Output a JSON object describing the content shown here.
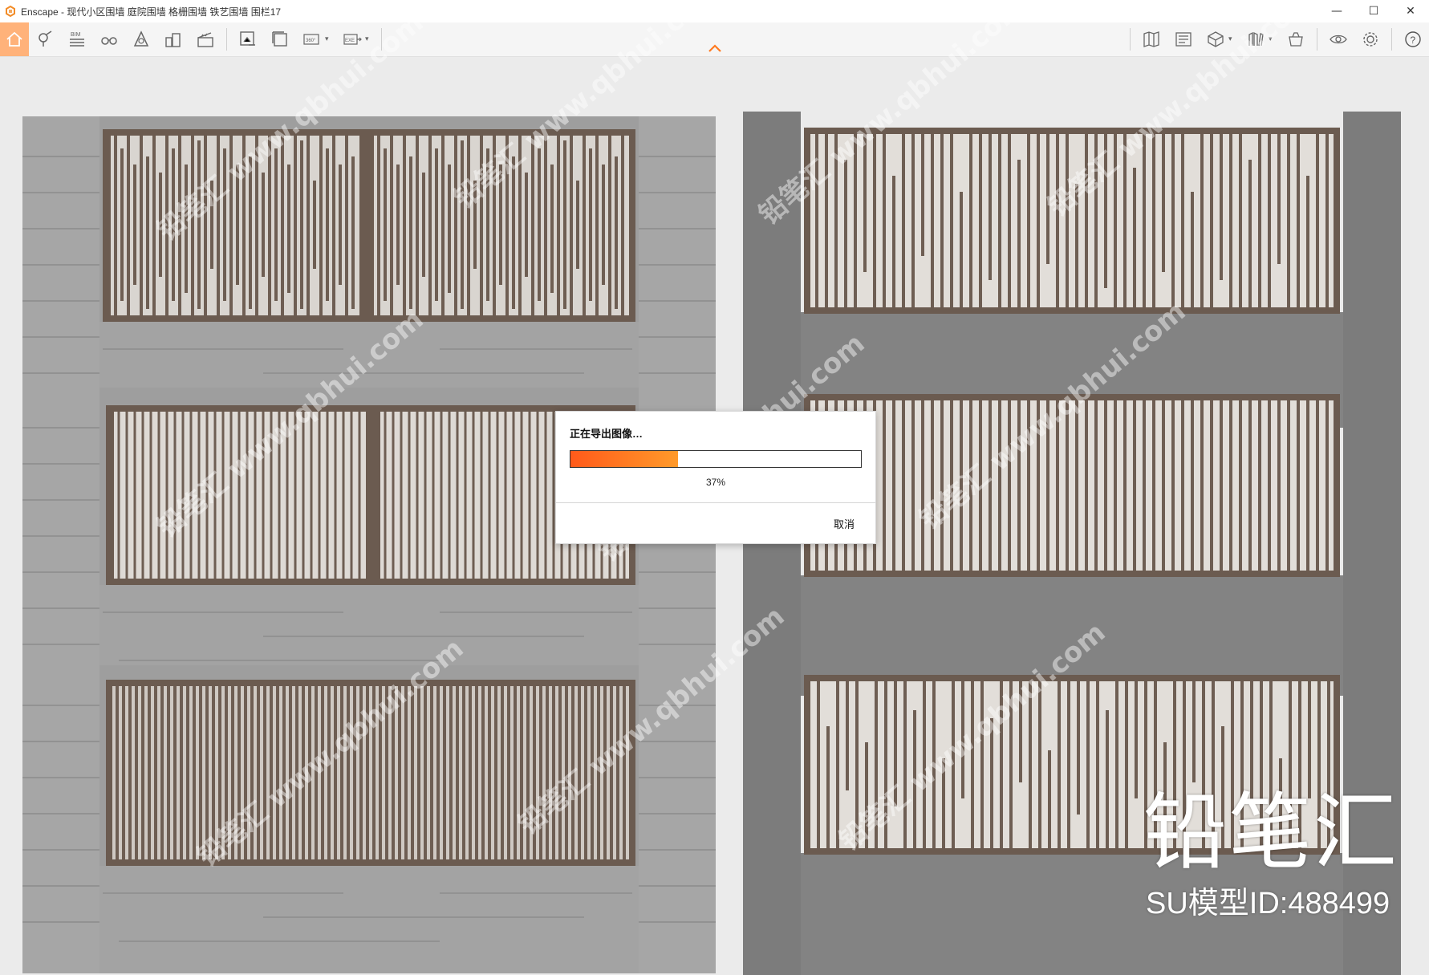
{
  "window": {
    "title": "Enscape - 现代小区围墙 庭院围墙 格栅围墙 铁艺围墙 围栏17",
    "controls": {
      "minimize": "—",
      "maximize": "☐",
      "close": "✕"
    }
  },
  "toolbar": {
    "left_icons": [
      "home-icon",
      "map-pin-icon",
      "bim-icon",
      "binoculars-icon",
      "atmosphere-icon",
      "buildings-icon",
      "clapper-icon",
      "export-image-icon",
      "batch-render-icon",
      "panorama-360-icon",
      "export-exe-icon"
    ],
    "right_icons": [
      "map-icon",
      "gallery-icon",
      "cube-icon",
      "library-icon",
      "asset-icon",
      "eye-icon",
      "settings-gear-icon",
      "help-icon"
    ],
    "bim_label": "BIM",
    "pano_label": "360°",
    "exe_label": "EXE",
    "help_label": "?"
  },
  "dialog": {
    "title": "正在导出图像…",
    "progress": 37,
    "progress_label": "37%",
    "cancel_label": "取消"
  },
  "watermark": {
    "logo_text": "铅笔汇",
    "id_text": "SU模型ID:488499"
  },
  "colors": {
    "accent": "#ff7a20",
    "home_highlight": "#ffb27a",
    "concrete": "#a7a7a7",
    "metal": "#6b5b50",
    "slat_light": "#d8d4cf"
  }
}
